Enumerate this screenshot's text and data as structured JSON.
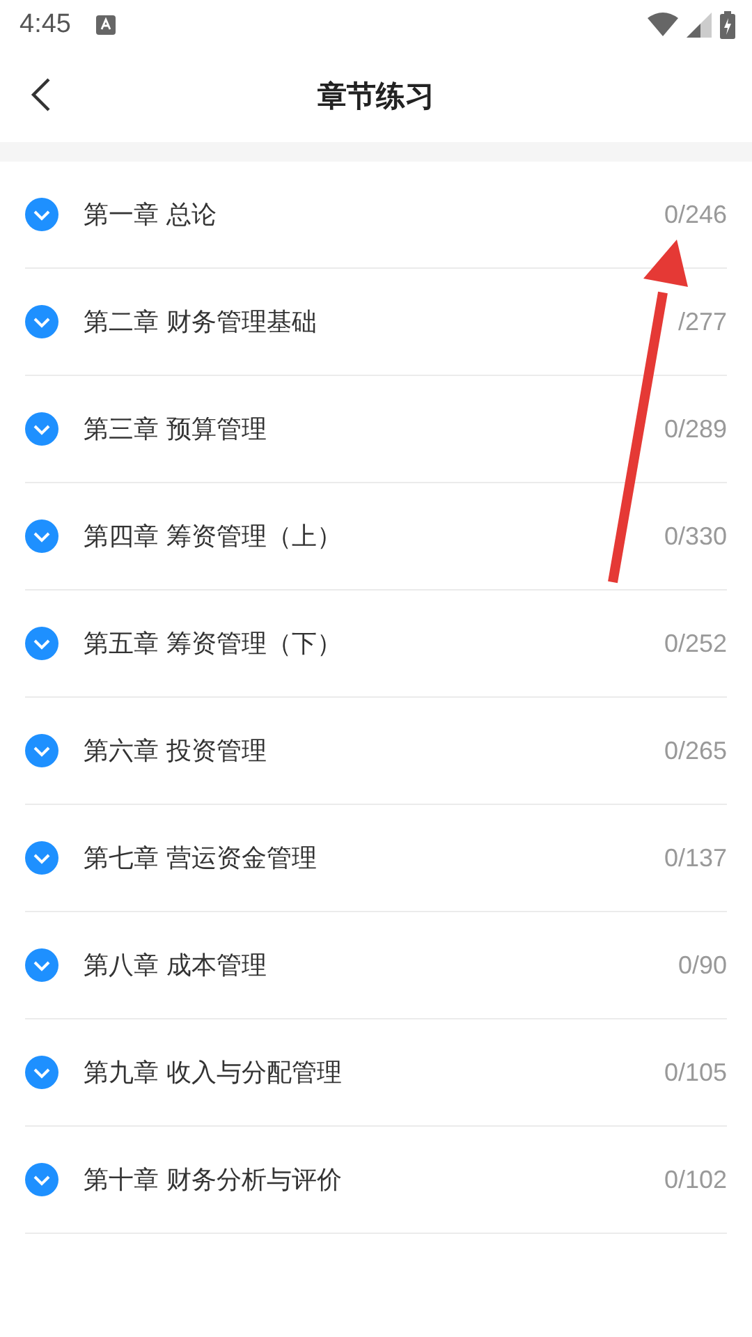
{
  "status_bar": {
    "time": "4:45"
  },
  "header": {
    "title": "章节练习"
  },
  "chapters": [
    {
      "title": "第一章 总论",
      "count": "0/246"
    },
    {
      "title": "第二章 财务管理基础",
      "count": "/277"
    },
    {
      "title": "第三章 预算管理",
      "count": "0/289"
    },
    {
      "title": "第四章 筹资管理（上）",
      "count": "0/330"
    },
    {
      "title": "第五章 筹资管理（下）",
      "count": "0/252"
    },
    {
      "title": "第六章 投资管理",
      "count": "0/265"
    },
    {
      "title": "第七章 营运资金管理",
      "count": "0/137"
    },
    {
      "title": "第八章 成本管理",
      "count": "0/90"
    },
    {
      "title": "第九章 收入与分配管理",
      "count": "0/105"
    },
    {
      "title": "第十章 财务分析与评价",
      "count": "0/102"
    }
  ]
}
